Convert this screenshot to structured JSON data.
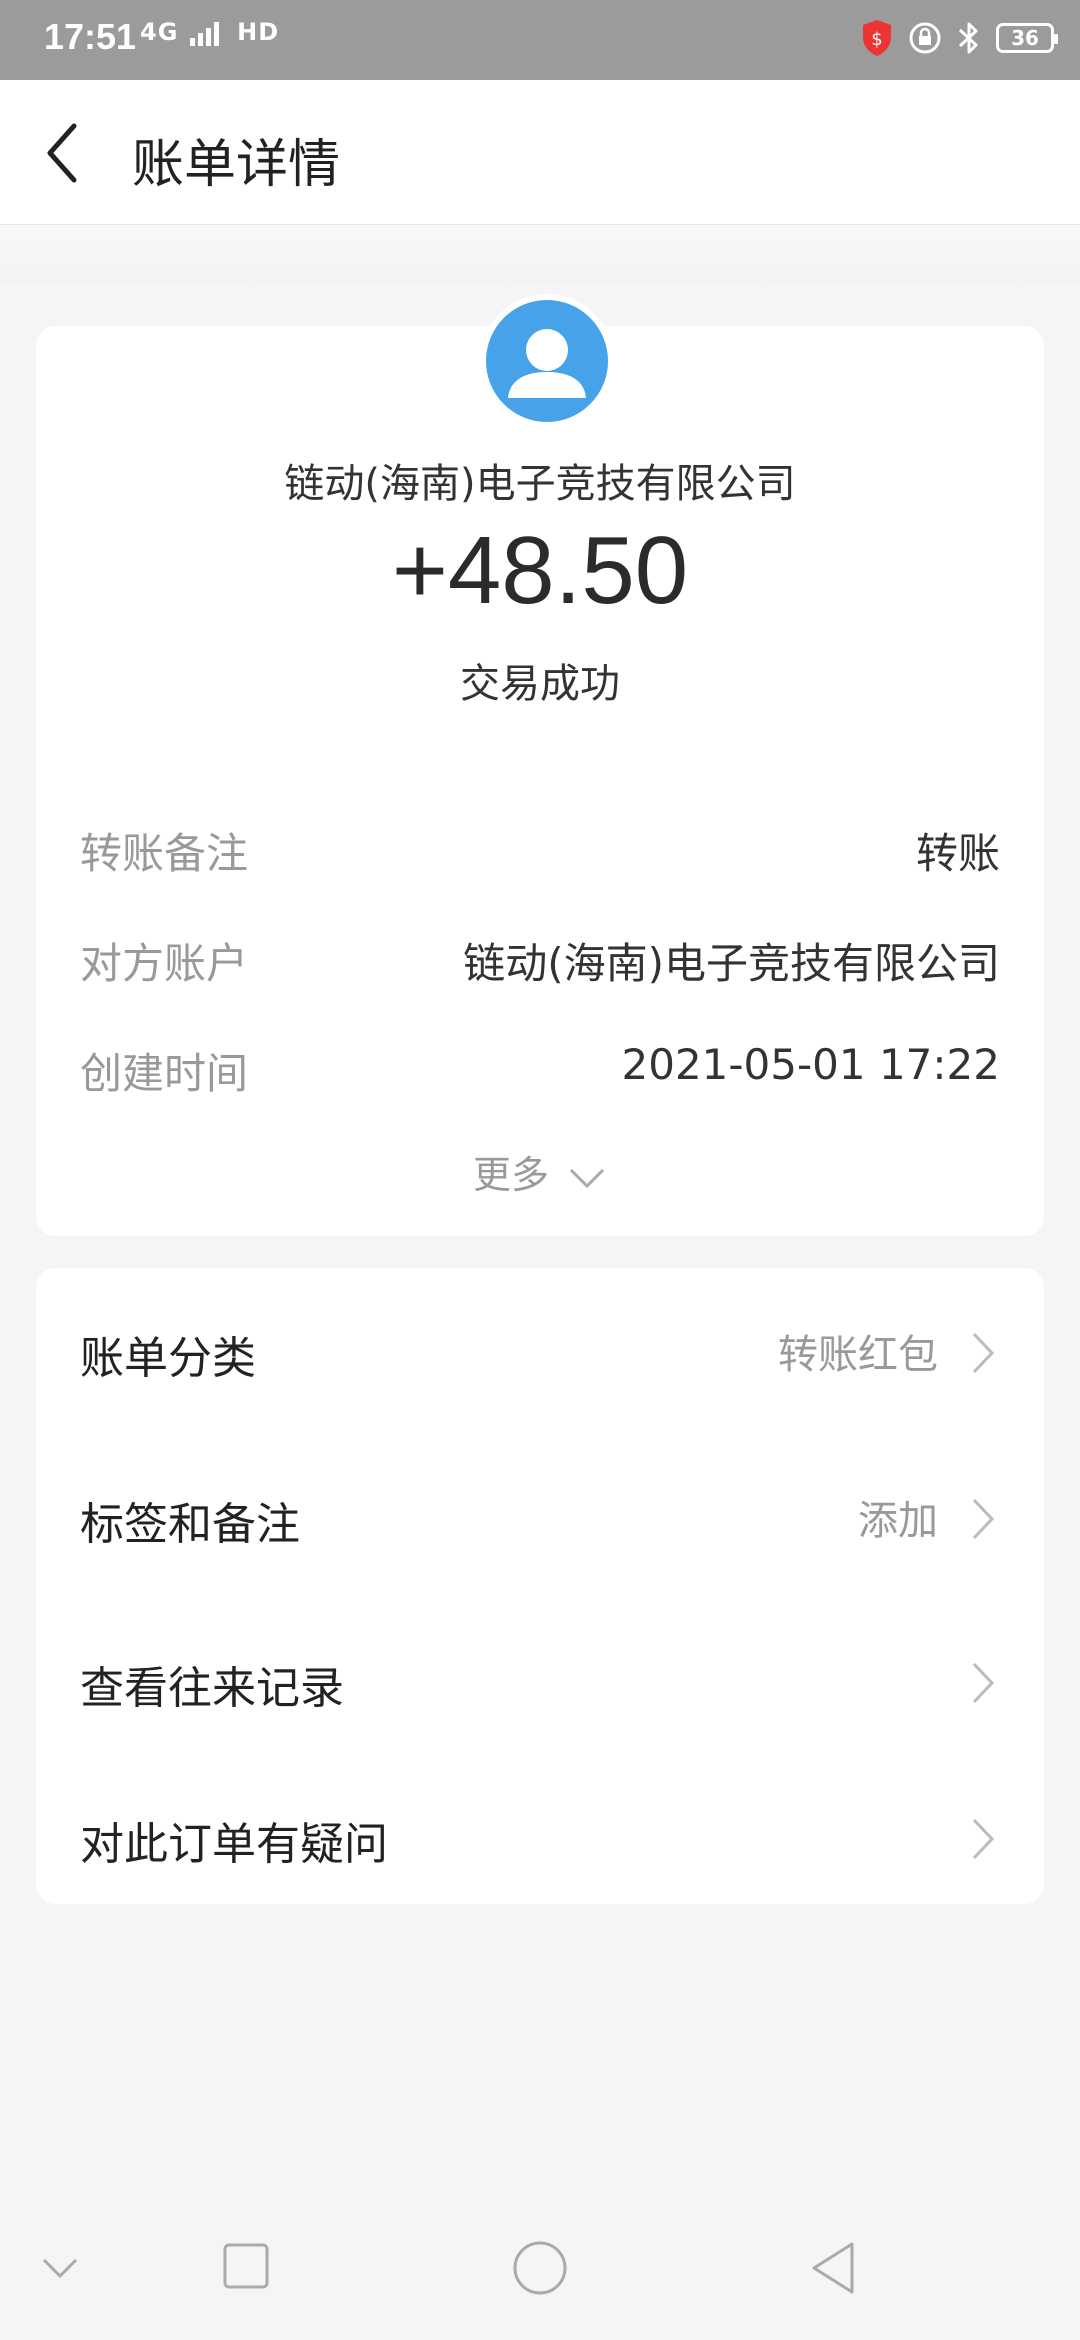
{
  "status_bar": {
    "time": "17:51",
    "network": "4G",
    "hd": "HD",
    "battery": "36"
  },
  "header": {
    "title": "账单详情"
  },
  "summary": {
    "company": "链动(海南)电子竞技有限公司",
    "amount": "+48.50",
    "status": "交易成功"
  },
  "details": [
    {
      "label": "转账备注",
      "value": "转账"
    },
    {
      "label": "对方账户",
      "value": "链动(海南)电子竞技有限公司"
    },
    {
      "label": "创建时间",
      "value": "2021-05-01 17:22"
    }
  ],
  "more_label": "更多",
  "menu": [
    {
      "label": "账单分类",
      "value": "转账红包"
    },
    {
      "label": "标签和备注",
      "value": "添加"
    },
    {
      "label": "查看往来记录",
      "value": ""
    },
    {
      "label": "对此订单有疑问",
      "value": ""
    }
  ],
  "colors": {
    "accent_avatar": "#46a3ea",
    "status_bar": "#9b9b9b",
    "background": "#f5f5f7"
  },
  "icons": {
    "back": "chevron-left-icon",
    "avatar": "user-icon",
    "more": "chevron-down-icon",
    "row": "chevron-right-icon"
  }
}
